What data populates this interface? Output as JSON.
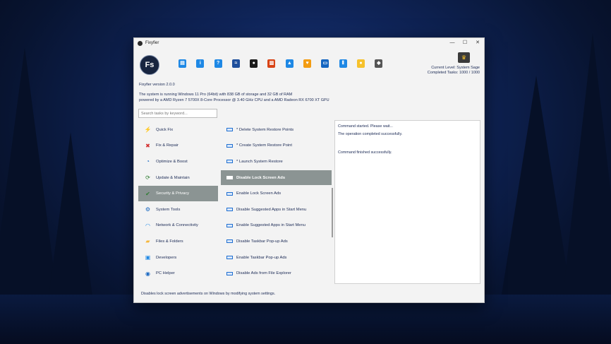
{
  "window": {
    "title": "Fixyfier",
    "controls": {
      "minimize": "—",
      "maximize": "☐",
      "close": "✕"
    }
  },
  "logo": "Fs",
  "toolbar": [
    {
      "name": "book-icon",
      "glyph": "▤",
      "color": "#1e88e5"
    },
    {
      "name": "info-icon",
      "glyph": "i",
      "color": "#1e88e5"
    },
    {
      "name": "help-icon",
      "glyph": "?",
      "color": "#1e88e5"
    },
    {
      "name": "aws-icon",
      "glyph": "≈",
      "color": "#1e4f9c"
    },
    {
      "name": "github-icon",
      "glyph": "●",
      "color": "#1a1a1a"
    },
    {
      "name": "store-icon",
      "glyph": "▥",
      "color": "#d84315"
    },
    {
      "name": "like-icon",
      "glyph": "▲",
      "color": "#1e88e5"
    },
    {
      "name": "heart-hand-icon",
      "glyph": "♥",
      "color": "#f39c12"
    },
    {
      "name": "layout-icon",
      "glyph": "▭",
      "color": "#1565c0"
    },
    {
      "name": "sliders-icon",
      "glyph": "⦀",
      "color": "#1e88e5"
    },
    {
      "name": "lightbulb-icon",
      "glyph": "●",
      "color": "#f6c12b"
    },
    {
      "name": "eraser-icon",
      "glyph": "◆",
      "color": "#555555"
    }
  ],
  "level": {
    "current": "Current Level: System Sage",
    "tasks": "Completed Tasks: 1000 / 1000"
  },
  "version": "Fixyfier version 2.0.0",
  "sysinfo": {
    "line1": "The system is running Windows 11 Pro (64bit) with 838 GB of storage and 32 GB of RAM",
    "line2": "powered by a AMD Ryzen 7 5700X 8-Core Processor @ 3.40 GHz CPU and a AMD Radeon RX 6700 XT GPU"
  },
  "search": {
    "placeholder": "Search tasks by keyword..."
  },
  "categories": [
    {
      "label": "Quick Fix",
      "icon": "lightning-icon",
      "glyph": "⚡",
      "color": "#f2b705"
    },
    {
      "label": "Fix & Repair",
      "icon": "wrench-icon",
      "glyph": "✖",
      "color": "#d32f2f"
    },
    {
      "label": "Optimize & Boost",
      "icon": "speedometer-icon",
      "glyph": "◔",
      "color": "#1565c0"
    },
    {
      "label": "Update & Maintain",
      "icon": "update-icon",
      "glyph": "⟳",
      "color": "#2e7d32"
    },
    {
      "label": "Security & Privacy",
      "icon": "shield-check-icon",
      "glyph": "✔",
      "color": "#2e7d32"
    },
    {
      "label": "System Tools",
      "icon": "gear-icon",
      "glyph": "⚙",
      "color": "#1565c0"
    },
    {
      "label": "Network & Connectivity",
      "icon": "wifi-icon",
      "glyph": "◠",
      "color": "#1e88e5"
    },
    {
      "label": "Files & Folders",
      "icon": "folder-icon",
      "glyph": "▰",
      "color": "#f6b73c"
    },
    {
      "label": "Developers",
      "icon": "code-icon",
      "glyph": "▣",
      "color": "#1e88e5"
    },
    {
      "label": "PC Helper",
      "icon": "robot-icon",
      "glyph": "◉",
      "color": "#1565c0"
    }
  ],
  "tasks": [
    "* Delete System Restore Points",
    "* Create System Restore Point",
    "* Launch System Restore",
    "Disable Lock Screen Ads",
    "Enable Lock Screen Ads",
    "Disable Suggested Apps in Start Menu",
    "Enable Suggested Apps in Start Menu",
    "Disable Taskbar Pop-up Ads",
    "Enable Taskbar Pop-up Ads",
    "Disable Ads from File Explorer"
  ],
  "active_category": 4,
  "active_task": 3,
  "output": {
    "line1": "Command started. Please wait...",
    "line2": "The operation completed successfully.",
    "line3": "Command finished successfully."
  },
  "status": "Disables lock screen advertisements on Windows by modifying system settings."
}
